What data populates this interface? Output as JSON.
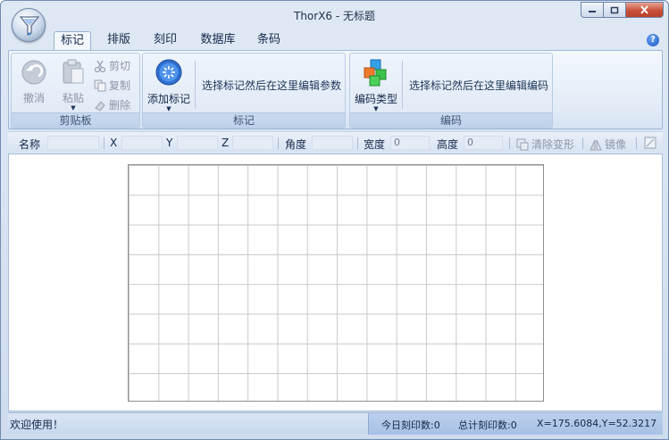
{
  "window": {
    "title": "ThorX6 - 无标题",
    "controls": {
      "minimize": "minimize-icon",
      "maximize": "maximize-icon",
      "close": "close-icon"
    }
  },
  "tabs": [
    {
      "label": "标记",
      "active": true
    },
    {
      "label": "排版",
      "active": false
    },
    {
      "label": "刻印",
      "active": false
    },
    {
      "label": "数据库",
      "active": false
    },
    {
      "label": "条码",
      "active": false
    }
  ],
  "ribbon": {
    "clipboard": {
      "label": "剪贴板",
      "undo": "撤消",
      "paste": "粘贴",
      "cut": "剪切",
      "copy": "复制",
      "delete": "删除"
    },
    "mark": {
      "label": "标记",
      "add_mark": "添加标记",
      "hint": "选择标记然后在这里编辑参数"
    },
    "code": {
      "label": "编码",
      "code_type": "编码类型",
      "hint": "选择标记然后在这里编辑编码"
    }
  },
  "propbar": {
    "name_label": "名称",
    "x_label": "X",
    "y_label": "Y",
    "z_label": "Z",
    "angle_label": "角度",
    "width_label": "宽度",
    "width_value": "0",
    "height_label": "高度",
    "height_value": "0",
    "clear_transform": "清除变形",
    "mirror": "镜像"
  },
  "status": {
    "welcome": "欢迎使用！",
    "today_count": "今日刻印数:0",
    "total_count": "总计刻印数:0",
    "coords": "X=175.6084,Y=52.3217"
  },
  "colors": {
    "frame": "#6f8cb3",
    "ribbon_bg": "#dde8f5",
    "close_button": "#c9513a",
    "grid_line": "#c9c9c9"
  }
}
